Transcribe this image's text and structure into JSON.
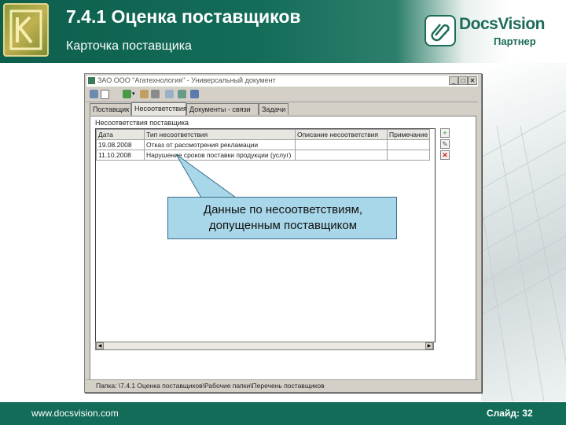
{
  "slide": {
    "title": "7.4.1  Оценка поставщиков",
    "subtitle": "Карточка поставщика",
    "brand_name": "DocsVision",
    "brand_partner": "Партнер",
    "footer_url": "www.docsvision.com",
    "footer_page": "Слайд: 32"
  },
  "window": {
    "title": "ЗАО ООО \"Агатехнология\" - Универсальный документ",
    "buttons": {
      "minimize": "_",
      "maximize": "□",
      "close": "✕"
    },
    "toolbar_icons": [
      "save-icon",
      "new-icon",
      "dropdown-icon",
      "edit-icon",
      "print-icon",
      "copy-icon",
      "tree-icon"
    ],
    "tabs": [
      {
        "label": "Поставщик"
      },
      {
        "label": "Несоответствия",
        "active": true
      },
      {
        "label": "Документы - связи"
      },
      {
        "label": "Задачи"
      }
    ],
    "group_label": "Несоответствия поставщика",
    "table": {
      "columns": [
        "Дата",
        "Тип несоответствия",
        "Описание несоответствия",
        "Примечание"
      ],
      "rows": [
        [
          "19.08.2008",
          "Отказ от рассмотрения рекламации",
          "",
          ""
        ],
        [
          "11.10.2008",
          "Нарушение сроков поставки продукции (услуг)",
          "",
          ""
        ]
      ]
    },
    "side_buttons": [
      "add-row-icon",
      "edit-row-icon",
      "delete-row-icon"
    ],
    "status": "Папка: \\7.4.1 Оценка поставщиков\\Рабочие папки\\Перечень поставщиков"
  },
  "callout": {
    "line1": "Данные по несоответствиям,",
    "line2": "допущенным поставщиком"
  },
  "colors": {
    "brand_green": "#136c58",
    "callout_fill": "#a9d7ea"
  }
}
